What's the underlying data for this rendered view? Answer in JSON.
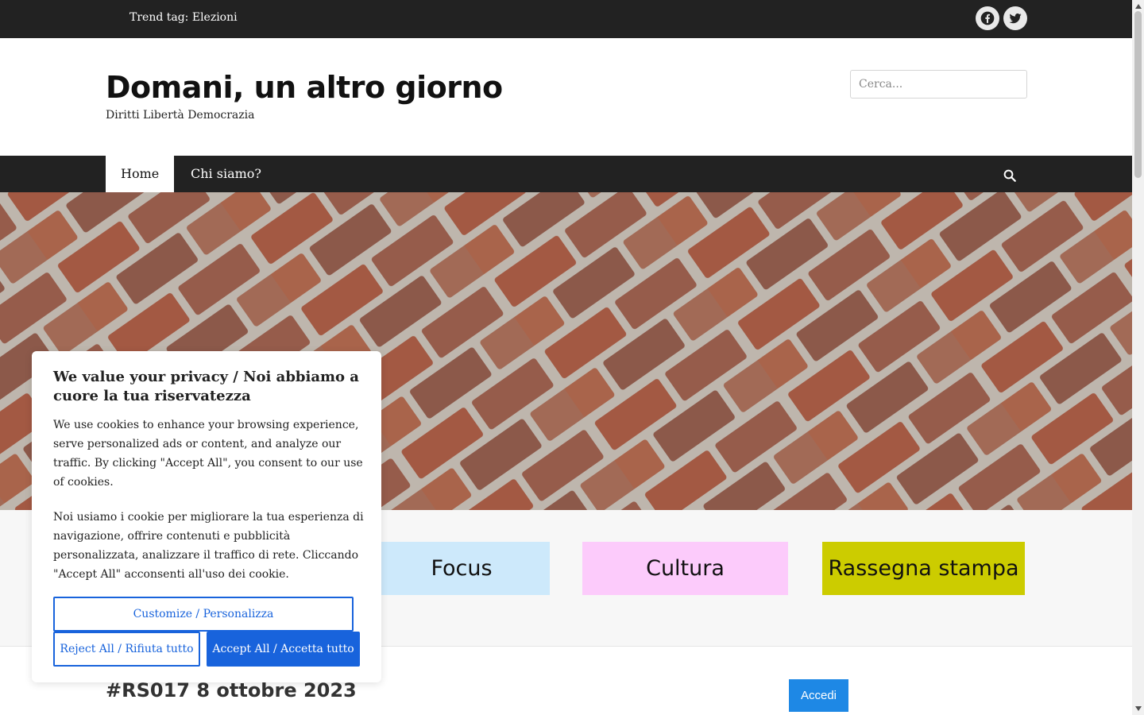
{
  "topbar": {
    "trend_text": "Trend tag: Elezioni",
    "social_icons": [
      "facebook-icon",
      "twitter-icon"
    ]
  },
  "header": {
    "site_title": "Domani, un altro giorno",
    "tagline": "Diritti Libertà Democrazia",
    "search_placeholder": "Cerca..."
  },
  "nav": {
    "items": [
      {
        "label": "Home",
        "active": true
      },
      {
        "label": "Chi siamo?",
        "active": false
      }
    ],
    "search_icon": "search-icon"
  },
  "categories": [
    {
      "label": "Focus",
      "color": "#cde9fb"
    },
    {
      "label": "Cultura",
      "color": "#fccbfb"
    },
    {
      "label": "Rassegna stampa",
      "color": "#cccc00"
    }
  ],
  "post": {
    "title": "#RS017 8 ottobre 2023"
  },
  "login": {
    "button_label": "Accedi"
  },
  "cookie_banner": {
    "title": "We value your privacy / Noi abbiamo a cuore la tua riservatezza",
    "text_en": "We use cookies to enhance your browsing experience, serve personalized ads or content, and analyze our traffic. By clicking \"Accept All\", you consent to our use of cookies.",
    "text_it": "Noi usiamo i cookie per migliorare la tua esperienza di navigazione, offrire contenuti e pubblicità personalizzata, analizzare il traffico di rete. Cliccando \"Accept All\" acconsenti all'uso dei cookie.",
    "customize_label": "Customize / Personalizza",
    "reject_label": "Reject All / Rifiuta tutto",
    "accept_label": "Accept All / Accetta tutto"
  },
  "colors": {
    "topbar_bg": "#222222",
    "accent_blue": "#1863dc",
    "login_blue": "#1e88e5"
  }
}
